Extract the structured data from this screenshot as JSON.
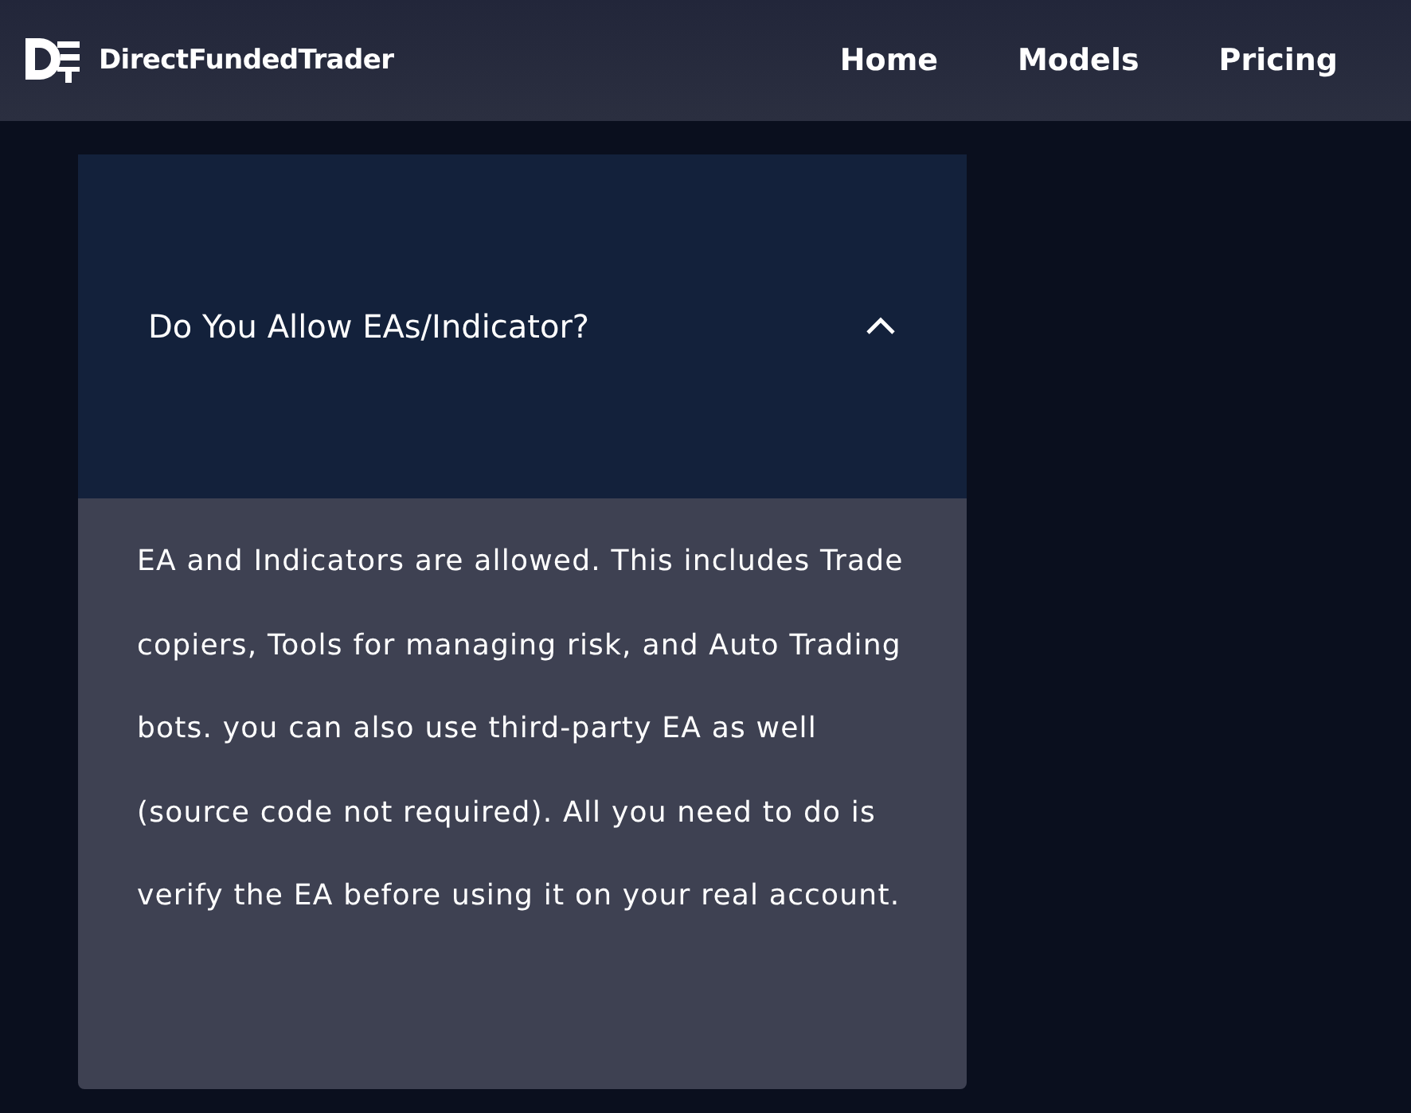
{
  "header": {
    "brand": "DirectFundedTrader",
    "nav": [
      {
        "label": "Home"
      },
      {
        "label": "Models"
      },
      {
        "label": "Pricing"
      }
    ]
  },
  "faq": {
    "question": "Do You Allow EAs/Indicator?",
    "expanded": true,
    "answer": "EA and Indicators are allowed. This includes Trade copiers, Tools for managing risk, and Auto Trading bots. you can also use third-party EA as well (source code not required). All you need to do is verify the EA before using it on your real account."
  }
}
